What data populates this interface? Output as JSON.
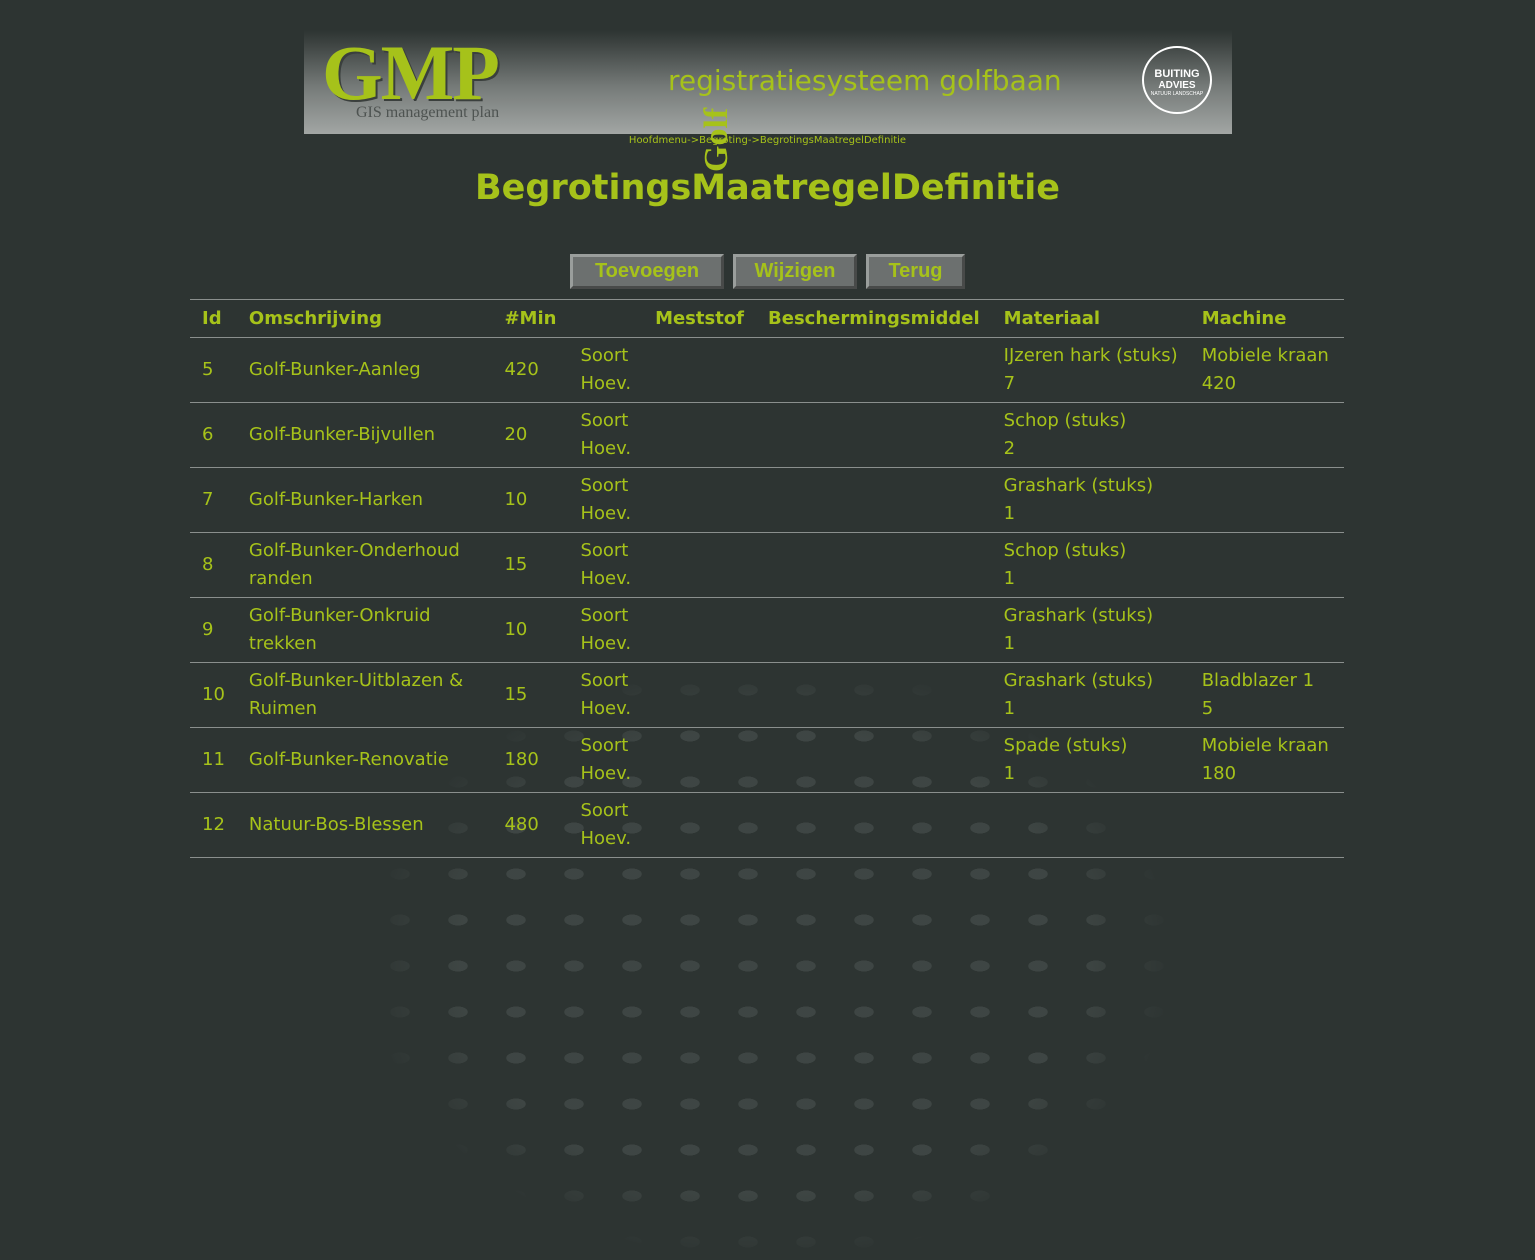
{
  "header": {
    "logo_text": "GMP",
    "logo_golf": "Golf",
    "logo_subtitle": "GIS management plan",
    "banner_title": "registratiesysteem golfbaan",
    "partner_logo": {
      "line1": "BUITING",
      "line2": "ADVIES",
      "line3": "NATUUR LANDSCHAP"
    }
  },
  "breadcrumb": [
    "Hoofdmenu->",
    "Begroting->",
    "BegrotingsMaatregelDefinitie"
  ],
  "page_title": "BegrotingsMaatregelDefinitie",
  "buttons": {
    "add": "Toevoegen",
    "edit": "Wijzigen",
    "back": "Terug"
  },
  "table": {
    "columns": [
      "Id",
      "Omschrijving",
      "#Min",
      "",
      "Meststof",
      "Beschermingsmiddel",
      "Materiaal",
      "Machine"
    ],
    "rows": [
      {
        "id": "5",
        "omschrijving": "Golf-Bunker-Aanleg",
        "min": "420",
        "soort": "Soort",
        "hoev": "Hoev.",
        "materiaal": "IJzeren hark (stuks)",
        "materiaal_qty": "7",
        "machine": "Mobiele kraan",
        "machine_qty": "420"
      },
      {
        "id": "6",
        "omschrijving": "Golf-Bunker-Bijvullen",
        "min": "20",
        "soort": "Soort",
        "hoev": "Hoev.",
        "materiaal": "Schop (stuks)",
        "materiaal_qty": "2",
        "machine": "",
        "machine_qty": ""
      },
      {
        "id": "7",
        "omschrijving": "Golf-Bunker-Harken",
        "min": "10",
        "soort": "Soort",
        "hoev": "Hoev.",
        "materiaal": "Grashark (stuks)",
        "materiaal_qty": "1",
        "machine": "",
        "machine_qty": ""
      },
      {
        "id": "8",
        "omschrijving": "Golf-Bunker-Onderhoud randen",
        "min": "15",
        "soort": "Soort",
        "hoev": "Hoev.",
        "materiaal": "Schop (stuks)",
        "materiaal_qty": "1",
        "machine": "",
        "machine_qty": ""
      },
      {
        "id": "9",
        "omschrijving": "Golf-Bunker-Onkruid trekken",
        "min": "10",
        "soort": "Soort",
        "hoev": "Hoev.",
        "materiaal": "Grashark (stuks)",
        "materiaal_qty": "1",
        "machine": "",
        "machine_qty": ""
      },
      {
        "id": "10",
        "omschrijving": "Golf-Bunker-Uitblazen & Ruimen",
        "min": "15",
        "soort": "Soort",
        "hoev": "Hoev.",
        "materiaal": "Grashark (stuks)",
        "materiaal_qty": "1",
        "machine": "Bladblazer 1",
        "machine_qty": "5"
      },
      {
        "id": "11",
        "omschrijving": "Golf-Bunker-Renovatie",
        "min": "180",
        "soort": "Soort",
        "hoev": "Hoev.",
        "materiaal": "Spade (stuks)",
        "materiaal_qty": "1",
        "machine": "Mobiele kraan",
        "machine_qty": "180"
      },
      {
        "id": "12",
        "omschrijving": "Natuur-Bos-Blessen",
        "min": "480",
        "soort": "Soort",
        "hoev": "Hoev.",
        "materiaal": "",
        "materiaal_qty": "",
        "machine": "",
        "machine_qty": ""
      }
    ]
  },
  "colors": {
    "background": "#2d3432",
    "accent": "#a6c21a",
    "rule": "#8a8f8d"
  }
}
